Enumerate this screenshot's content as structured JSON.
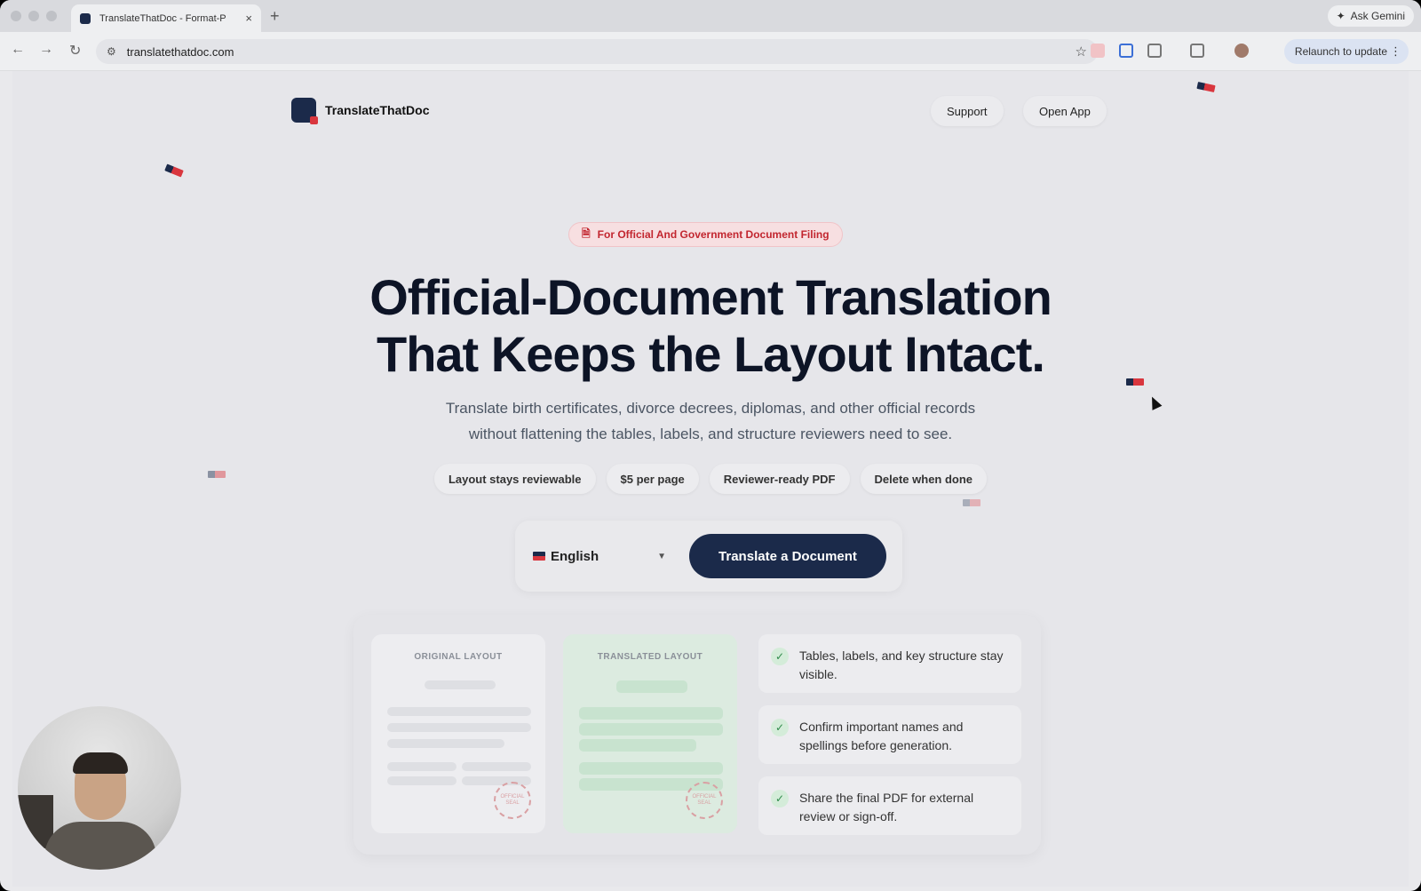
{
  "browser": {
    "tab_title": "TranslateThatDoc - Format-P",
    "new_tab_symbol": "+",
    "close_symbol": "×",
    "gemini_label": "Ask Gemini",
    "url": "translatethatdoc.com",
    "relaunch_label": "Relaunch to update"
  },
  "nav": {
    "brand": "TranslateThatDoc",
    "support": "Support",
    "open_app": "Open App"
  },
  "hero": {
    "badge": "For Official And Government Document Filing",
    "title_line1": "Official-Document Translation",
    "title_line2": "That Keeps the Layout Intact.",
    "subtitle_line1": "Translate birth certificates, divorce decrees, diplomas, and other official records",
    "subtitle_line2": "without flattening the tables, labels, and structure reviewers need to see.",
    "chips": [
      "Layout stays reviewable",
      "$5 per page",
      "Reviewer-ready PDF",
      "Delete when done"
    ]
  },
  "cta": {
    "language": "English",
    "button": "Translate a Document"
  },
  "preview": {
    "original_label": "ORIGINAL LAYOUT",
    "translated_label": "TRANSLATED LAYOUT",
    "seal_text": "OFFICIAL SEAL",
    "features": [
      "Tables, labels, and key structure stay visible.",
      "Confirm important names and spellings before generation.",
      "Share the final PDF for external review or sign-off."
    ]
  },
  "colors": {
    "brand_navy": "#1b2a4a",
    "accent_red": "#c2262f",
    "check_green": "#2f8a4a"
  }
}
